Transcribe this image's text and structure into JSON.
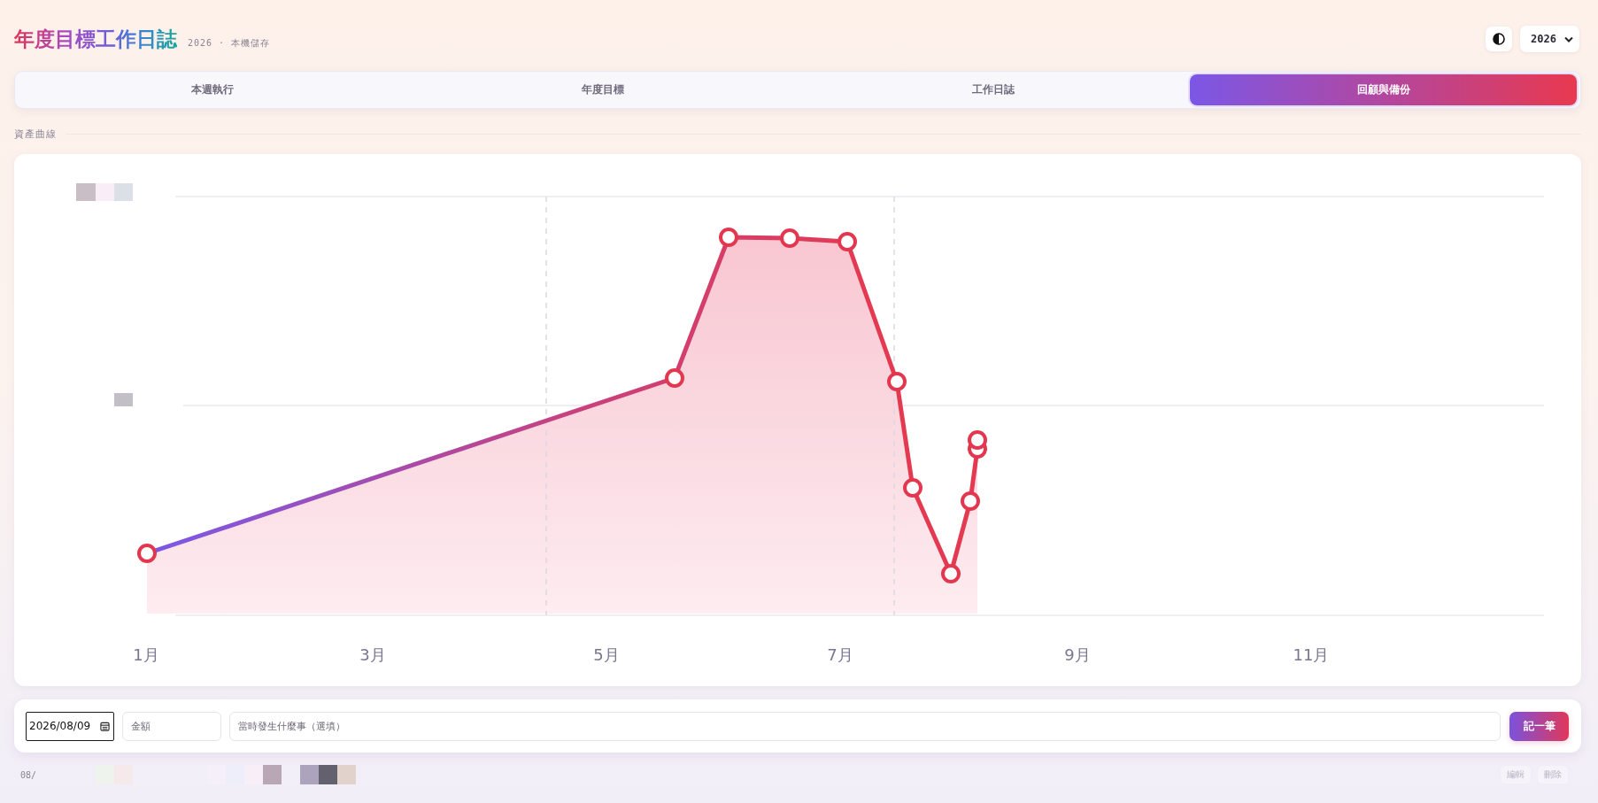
{
  "header": {
    "title": "年度目標工作日誌",
    "subtitle": "2026 · 本機儲存",
    "year_select": {
      "value": "2026"
    }
  },
  "tabs": [
    {
      "label": "本週執行",
      "selected": false
    },
    {
      "label": "年度目標",
      "selected": false
    },
    {
      "label": "工作日誌",
      "selected": false
    },
    {
      "label": "回顧與備份",
      "selected": true
    }
  ],
  "section": {
    "title": "資產曲線"
  },
  "chart": {
    "x_labels": [
      "1月",
      "3月",
      "5月",
      "7月",
      "9月",
      "11月"
    ]
  },
  "entry_form": {
    "date": {
      "value": "2026/08/09"
    },
    "amount": {
      "placeholder": "金額"
    },
    "note": {
      "placeholder": "當時發生什麼事（選填）"
    },
    "submit": "記一筆"
  },
  "entries": [
    {
      "date": "08/",
      "actions": [
        "編輯",
        "刪除"
      ]
    }
  ]
}
